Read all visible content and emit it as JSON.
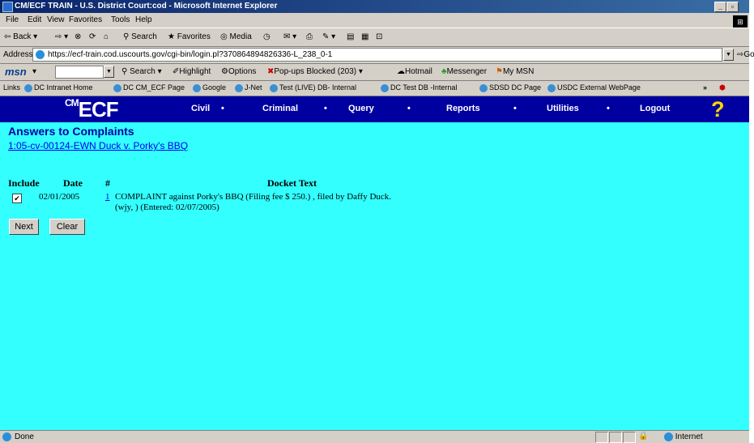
{
  "window": {
    "title": "CM/ECF TRAIN - U.S. District Court:cod - Microsoft Internet Explorer"
  },
  "menu": [
    "File",
    "Edit",
    "View",
    "Favorites",
    "Tools",
    "Help"
  ],
  "toolbar": {
    "back": "Back",
    "search": "Search",
    "favorites": "Favorites",
    "media": "Media"
  },
  "address": {
    "label": "Address",
    "url": "https://ecf-train.cod.uscourts.gov/cgi-bin/login.pl?370864894826336-L_238_0-1",
    "go": "Go"
  },
  "msn": {
    "logo": "msn",
    "search": "Search",
    "highlight": "Highlight",
    "options": "Options",
    "popups": "Pop-ups Blocked (203)",
    "hotmail": "Hotmail",
    "messenger": "Messenger",
    "mymsn": "My MSN"
  },
  "links": {
    "label": "Links",
    "items": [
      "DC Intranet Home",
      "DC CM_ECF Page",
      "Google",
      "J-Net",
      "Test (LIVE) DB- Internal",
      "DC Test DB -Internal",
      "SDSD DC Page",
      "USDC External WebPage"
    ]
  },
  "ecf": {
    "logo": "ECF",
    "nav": [
      "Civil",
      "Criminal",
      "Query",
      "Reports",
      "Utilities",
      "Logout"
    ]
  },
  "page": {
    "title": "Answers to Complaints",
    "case_link": "1:05-cv-00124-EWN Duck v. Porky's BBQ",
    "headers": {
      "include": "Include",
      "date": "Date",
      "num": "#",
      "docket": "Docket Text"
    },
    "entry": {
      "checked": true,
      "date": "02/01/2005",
      "num": "1",
      "text_line1": "COMPLAINT against Porky's BBQ (Filing fee $ 250.) , filed by Daffy Duck.",
      "text_line2": "(wjy, ) (Entered: 02/07/2005)"
    },
    "buttons": {
      "next": "Next",
      "clear": "Clear"
    }
  },
  "status": {
    "text": "Done",
    "zone": "Internet"
  }
}
